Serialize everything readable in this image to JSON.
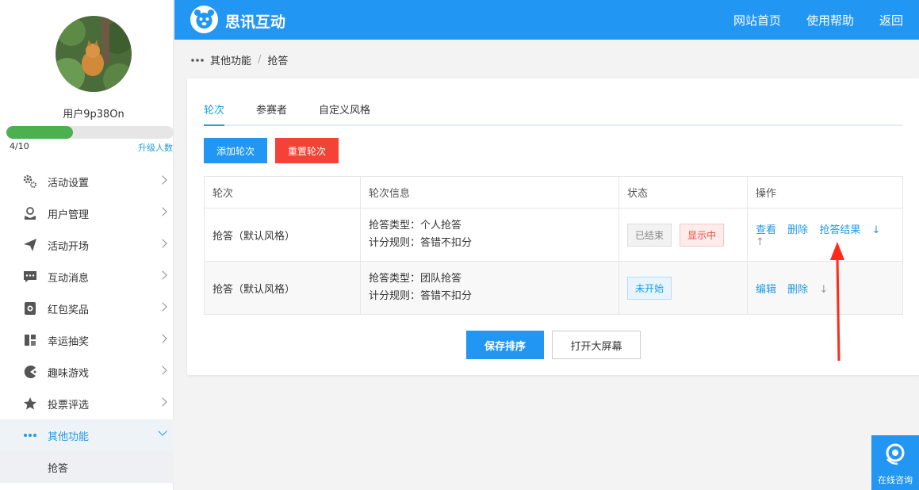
{
  "sidebar": {
    "username": "用户9p38On",
    "progress": {
      "current": 4,
      "max": 10,
      "label": "4/10",
      "fraction": 0.4
    },
    "upgrade_label": "升级人数",
    "menu": [
      {
        "label": "活动设置",
        "icon": "gear-icon"
      },
      {
        "label": "用户管理",
        "icon": "user-manage-icon"
      },
      {
        "label": "活动开场",
        "icon": "paper-plane-icon"
      },
      {
        "label": "互动消息",
        "icon": "chat-bubble-icon"
      },
      {
        "label": "红包奖品",
        "icon": "red-packet-icon"
      },
      {
        "label": "幸运抽奖",
        "icon": "lottery-icon"
      },
      {
        "label": "趣味游戏",
        "icon": "game-icon"
      },
      {
        "label": "投票评选",
        "icon": "star-icon"
      },
      {
        "label": "其他功能",
        "icon": "more-dots-icon"
      }
    ],
    "submenu": [
      {
        "label": "抢答"
      }
    ]
  },
  "header": {
    "brand": "思讯互动",
    "nav": [
      {
        "label": "网站首页"
      },
      {
        "label": "使用帮助"
      },
      {
        "label": "返回"
      }
    ]
  },
  "breadcrumb": {
    "parent": "其他功能",
    "separator": "/",
    "current": "抢答"
  },
  "tabs": [
    {
      "label": "轮次"
    },
    {
      "label": "参赛者"
    },
    {
      "label": "自定义风格"
    }
  ],
  "actions": {
    "add_round": "添加轮次",
    "reset_round": "重置轮次",
    "save_order": "保存排序",
    "open_screen": "打开大屏幕"
  },
  "table": {
    "headers": [
      "轮次",
      "轮次信息",
      "状态",
      "操作"
    ],
    "rows": [
      {
        "round": "抢答（默认风格）",
        "info_type": "抢答类型：个人抢答",
        "info_score": "计分规则：答错不扣分",
        "status": [
          "已结束",
          "显示中"
        ],
        "ops": [
          "查看",
          "删除",
          "抢答结果"
        ],
        "arrows": [
          "↓",
          "↑"
        ]
      },
      {
        "round": "抢答（默认风格）",
        "info_type": "抢答类型：团队抢答",
        "info_score": "计分规则：答错不扣分",
        "status": [
          "未开始"
        ],
        "ops": [
          "编辑",
          "删除"
        ],
        "arrows": [
          "↓"
        ]
      }
    ]
  },
  "consult": {
    "label": "在线咨询",
    "icon": "headset-icon"
  },
  "colors": {
    "primary": "#2196f3",
    "danger": "#f44336",
    "progress": "#4caf50"
  }
}
